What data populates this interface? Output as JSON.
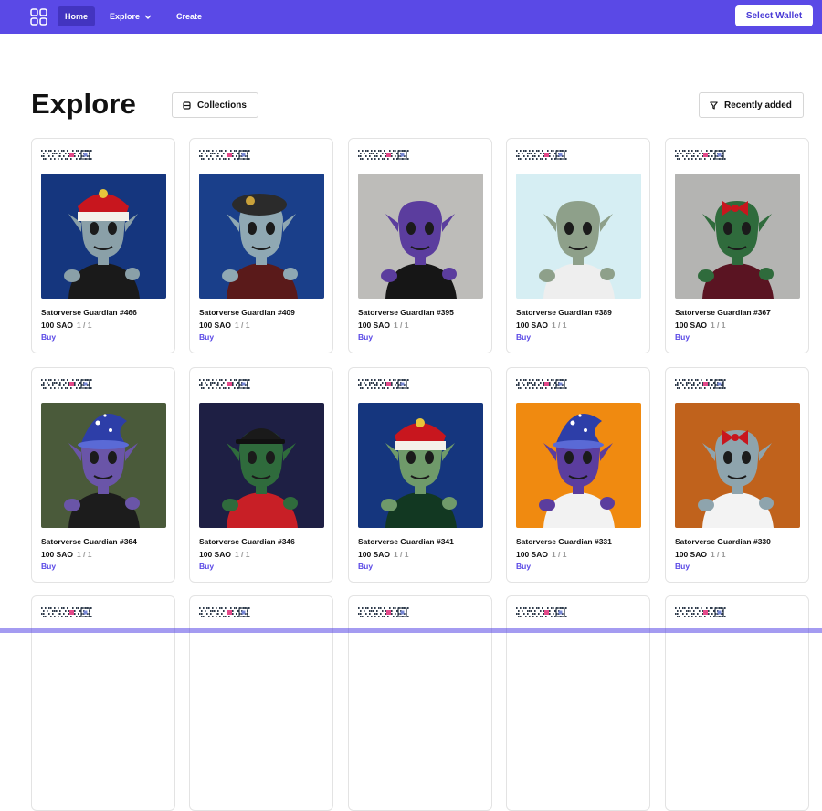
{
  "topbar": {
    "logo_icon": "grid-icon",
    "nav": [
      {
        "label": "Home",
        "active": true
      },
      {
        "label": "Explore",
        "has_dropdown": true
      },
      {
        "label": "Create"
      }
    ],
    "wallet_button": "Select Wallet"
  },
  "page": {
    "title": "Explore",
    "collections_button": "Collections",
    "sort_button": "Recently added"
  },
  "colors": {
    "brand": "#5a49e6",
    "buy": "#5a49e6"
  },
  "cards": [
    {
      "name": "Satorverse Guardian #466",
      "price": "100 SAO",
      "edition": "1 / 1",
      "action": "Buy",
      "bg": "#15367e",
      "skin": "#8aa0a8",
      "hat": "crown",
      "shirt": "#1a1a1a"
    },
    {
      "name": "Satorverse Guardian #409",
      "price": "100 SAO",
      "edition": "1 / 1",
      "action": "Buy",
      "bg": "#1a3f8a",
      "skin": "#8fa8b3",
      "hat": "beret",
      "shirt": "#5a1a1a"
    },
    {
      "name": "Satorverse Guardian #395",
      "price": "100 SAO",
      "edition": "1 / 1",
      "action": "Buy",
      "bg": "#bdbcb9",
      "skin": "#5b3d9e",
      "hat": "none",
      "shirt": "#161616"
    },
    {
      "name": "Satorverse Guardian #389",
      "price": "100 SAO",
      "edition": "1 / 1",
      "action": "Buy",
      "bg": "#d6eef3",
      "skin": "#8ea08a",
      "hat": "none",
      "shirt": "#eeeeee"
    },
    {
      "name": "Satorverse Guardian #367",
      "price": "100 SAO",
      "edition": "1 / 1",
      "action": "Buy",
      "bg": "#b4b4b2",
      "skin": "#2f6b3c",
      "hat": "bow",
      "shirt": "#5a1422"
    },
    {
      "name": "Satorverse Guardian #364",
      "price": "100 SAO",
      "edition": "1 / 1",
      "action": "Buy",
      "bg": "#4a5a3a",
      "skin": "#6a55a8",
      "hat": "wizard",
      "shirt": "#1c1c1c"
    },
    {
      "name": "Satorverse Guardian #346",
      "price": "100 SAO",
      "edition": "1 / 1",
      "action": "Buy",
      "bg": "#1e1f44",
      "skin": "#2f6b3c",
      "hat": "cap",
      "shirt": "#c81f26"
    },
    {
      "name": "Satorverse Guardian #341",
      "price": "100 SAO",
      "edition": "1 / 1",
      "action": "Buy",
      "bg": "#15367e",
      "skin": "#6f9a6a",
      "hat": "crown",
      "shirt": "#123822"
    },
    {
      "name": "Satorverse Guardian #331",
      "price": "100 SAO",
      "edition": "1 / 1",
      "action": "Buy",
      "bg": "#f08a10",
      "skin": "#5b3d9e",
      "hat": "wizard",
      "shirt": "#f2f2f2"
    },
    {
      "name": "Satorverse Guardian #330",
      "price": "100 SAO",
      "edition": "1 / 1",
      "action": "Buy",
      "bg": "#c0621c",
      "skin": "#8ea4ad",
      "hat": "bow",
      "shirt": "#f3f3f3"
    }
  ]
}
